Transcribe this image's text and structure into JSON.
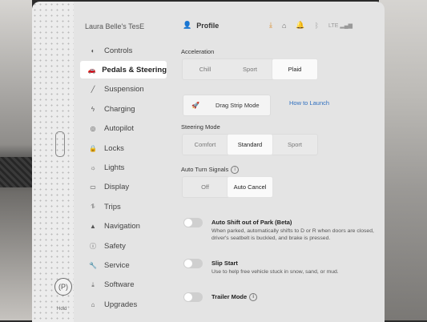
{
  "car_name": "Laura Belle's TesE",
  "hold_label": "Hold",
  "header": {
    "profile_label": "Profile",
    "signal_label": "LTE"
  },
  "menu": [
    {
      "label": "Controls",
      "icon": "toggle-icon",
      "glyph": "◐"
    },
    {
      "label": "Pedals & Steering",
      "icon": "car-icon",
      "glyph": "🚗"
    },
    {
      "label": "Suspension",
      "icon": "suspension-icon",
      "glyph": "╱"
    },
    {
      "label": "Charging",
      "icon": "lightning-icon",
      "glyph": "ϟ"
    },
    {
      "label": "Autopilot",
      "icon": "steering-wheel-icon",
      "glyph": "◎"
    },
    {
      "label": "Locks",
      "icon": "lock-icon",
      "glyph": "🔒"
    },
    {
      "label": "Lights",
      "icon": "sun-icon",
      "glyph": "☼"
    },
    {
      "label": "Display",
      "icon": "display-icon",
      "glyph": "▭"
    },
    {
      "label": "Trips",
      "icon": "trips-icon",
      "glyph": "⥮"
    },
    {
      "label": "Navigation",
      "icon": "navigation-icon",
      "glyph": "▲"
    },
    {
      "label": "Safety",
      "icon": "safety-icon",
      "glyph": "ⓘ"
    },
    {
      "label": "Service",
      "icon": "wrench-icon",
      "glyph": "🔧"
    },
    {
      "label": "Software",
      "icon": "download-icon",
      "glyph": "⤓"
    },
    {
      "label": "Upgrades",
      "icon": "upgrades-icon",
      "glyph": "⌂"
    }
  ],
  "active_menu": "Pedals & Steering",
  "acceleration": {
    "label": "Acceleration",
    "options": [
      "Chill",
      "Sport",
      "Plaid"
    ],
    "selected": "Plaid"
  },
  "drag_strip": {
    "button_label": "Drag Strip Mode",
    "link_label": "How to Launch"
  },
  "steering_mode": {
    "label": "Steering Mode",
    "options": [
      "Comfort",
      "Standard",
      "Sport"
    ],
    "selected": "Standard"
  },
  "auto_turn_signals": {
    "label": "Auto Turn Signals",
    "options": [
      "Off",
      "Auto Cancel"
    ],
    "selected": "Auto Cancel"
  },
  "auto_shift": {
    "title": "Auto Shift out of Park (Beta)",
    "description": "When parked, automatically shifts to D or R when doors are closed, driver's seatbelt is buckled, and brake is pressed.",
    "enabled": false
  },
  "slip_start": {
    "title": "Slip Start",
    "description": "Use to help free vehicle stuck in snow, sand, or mud.",
    "enabled": false
  },
  "trailer_mode": {
    "title": "Trailer Mode",
    "enabled": false
  },
  "colors": {
    "link": "#2f6fbf",
    "download_icon": "#d88a2a"
  }
}
